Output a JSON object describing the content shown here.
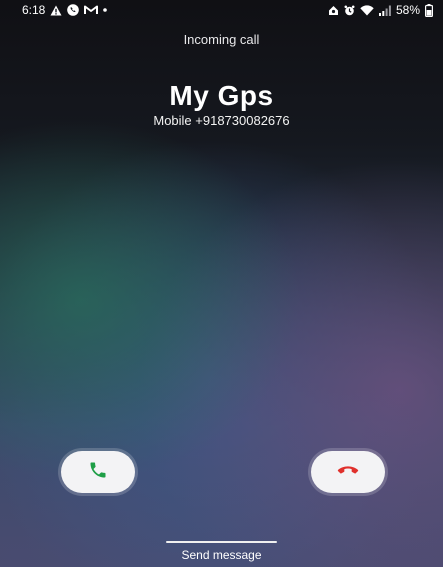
{
  "status_bar": {
    "time": "6:18",
    "battery": "58%",
    "left_icons": [
      "warning-icon",
      "phone-icon",
      "gmail-icon",
      "dot-icon"
    ],
    "right_icons": [
      "alarm-icon",
      "alarm-clock-icon",
      "wifi-icon",
      "signal-icon"
    ]
  },
  "call": {
    "status": "Incoming call",
    "caller_name": "My Gps",
    "caller_number": "Mobile +918730082676"
  },
  "actions": {
    "accept_icon": "phone-accept-icon",
    "decline_icon": "phone-decline-icon",
    "send_message": "Send message"
  },
  "colors": {
    "accept": "#1e9e46",
    "decline": "#e0302c"
  }
}
